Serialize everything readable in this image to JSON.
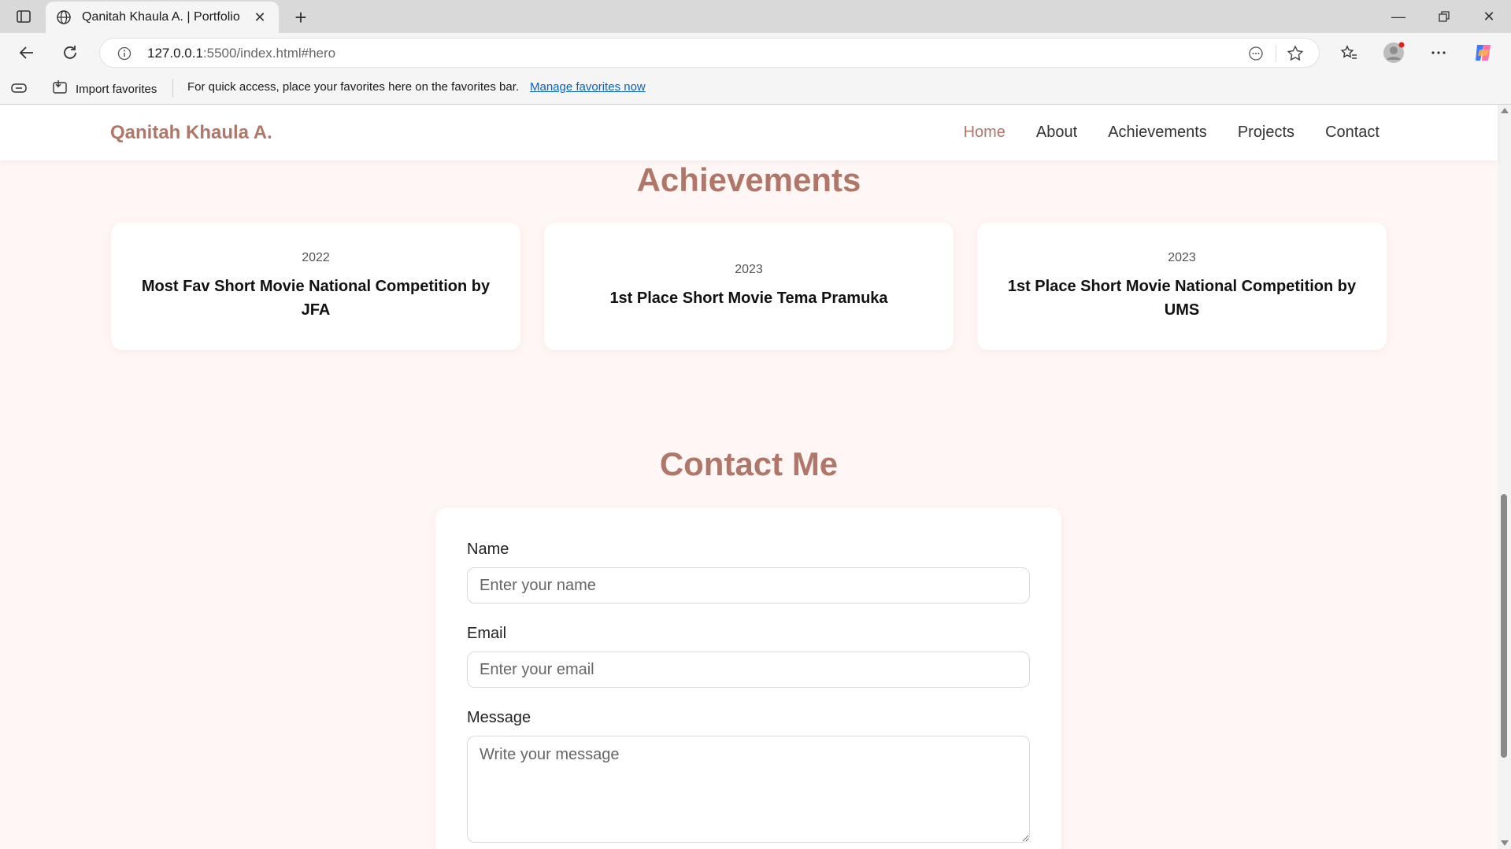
{
  "browser": {
    "tab_title": "Qanitah Khaula A. | Portfolio",
    "url_host": "127.0.0.1",
    "url_rest": ":5500/index.html#hero",
    "favorites_import": "Import favorites",
    "favorites_message": "For quick access, place your favorites here on the favorites bar.",
    "favorites_link": "Manage favorites now"
  },
  "site": {
    "logo": "Qanitah Khaula A.",
    "nav": [
      {
        "label": "Home",
        "active": true
      },
      {
        "label": "About"
      },
      {
        "label": "Achievements"
      },
      {
        "label": "Projects"
      },
      {
        "label": "Contact"
      }
    ]
  },
  "achievements": {
    "title": "Achievements",
    "items": [
      {
        "year": "2022",
        "title": "Most Fav Short Movie National Competition by JFA"
      },
      {
        "year": "2023",
        "title": "1st Place Short Movie Tema Pramuka"
      },
      {
        "year": "2023",
        "title": "1st Place Short Movie National Competition by UMS"
      }
    ]
  },
  "contact": {
    "title": "Contact Me",
    "name_label": "Name",
    "name_placeholder": "Enter your name",
    "email_label": "Email",
    "email_placeholder": "Enter your email",
    "message_label": "Message",
    "message_placeholder": "Write your message"
  },
  "colors": {
    "accent": "#b07768",
    "page_bg": "#fff7f5"
  }
}
